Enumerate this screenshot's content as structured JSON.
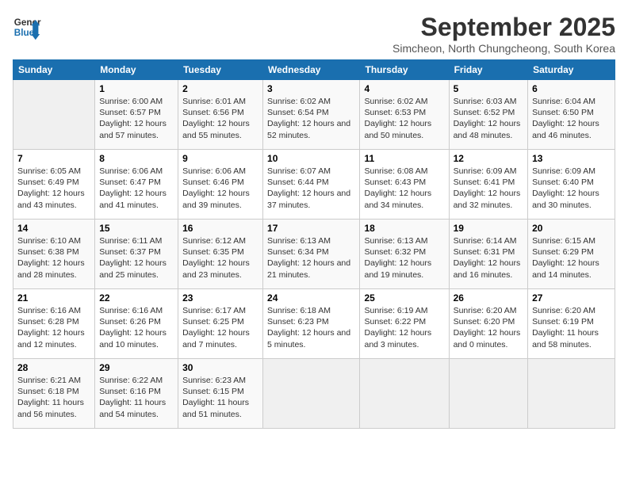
{
  "logo": {
    "line1": "General",
    "line2": "Blue"
  },
  "title": "September 2025",
  "subtitle": "Simcheon, North Chungcheong, South Korea",
  "days_of_week": [
    "Sunday",
    "Monday",
    "Tuesday",
    "Wednesday",
    "Thursday",
    "Friday",
    "Saturday"
  ],
  "weeks": [
    [
      {
        "day": "",
        "info": ""
      },
      {
        "day": "1",
        "info": "Sunrise: 6:00 AM\nSunset: 6:57 PM\nDaylight: 12 hours\nand 57 minutes."
      },
      {
        "day": "2",
        "info": "Sunrise: 6:01 AM\nSunset: 6:56 PM\nDaylight: 12 hours\nand 55 minutes."
      },
      {
        "day": "3",
        "info": "Sunrise: 6:02 AM\nSunset: 6:54 PM\nDaylight: 12 hours\nand 52 minutes."
      },
      {
        "day": "4",
        "info": "Sunrise: 6:02 AM\nSunset: 6:53 PM\nDaylight: 12 hours\nand 50 minutes."
      },
      {
        "day": "5",
        "info": "Sunrise: 6:03 AM\nSunset: 6:52 PM\nDaylight: 12 hours\nand 48 minutes."
      },
      {
        "day": "6",
        "info": "Sunrise: 6:04 AM\nSunset: 6:50 PM\nDaylight: 12 hours\nand 46 minutes."
      }
    ],
    [
      {
        "day": "7",
        "info": "Sunrise: 6:05 AM\nSunset: 6:49 PM\nDaylight: 12 hours\nand 43 minutes."
      },
      {
        "day": "8",
        "info": "Sunrise: 6:06 AM\nSunset: 6:47 PM\nDaylight: 12 hours\nand 41 minutes."
      },
      {
        "day": "9",
        "info": "Sunrise: 6:06 AM\nSunset: 6:46 PM\nDaylight: 12 hours\nand 39 minutes."
      },
      {
        "day": "10",
        "info": "Sunrise: 6:07 AM\nSunset: 6:44 PM\nDaylight: 12 hours\nand 37 minutes."
      },
      {
        "day": "11",
        "info": "Sunrise: 6:08 AM\nSunset: 6:43 PM\nDaylight: 12 hours\nand 34 minutes."
      },
      {
        "day": "12",
        "info": "Sunrise: 6:09 AM\nSunset: 6:41 PM\nDaylight: 12 hours\nand 32 minutes."
      },
      {
        "day": "13",
        "info": "Sunrise: 6:09 AM\nSunset: 6:40 PM\nDaylight: 12 hours\nand 30 minutes."
      }
    ],
    [
      {
        "day": "14",
        "info": "Sunrise: 6:10 AM\nSunset: 6:38 PM\nDaylight: 12 hours\nand 28 minutes."
      },
      {
        "day": "15",
        "info": "Sunrise: 6:11 AM\nSunset: 6:37 PM\nDaylight: 12 hours\nand 25 minutes."
      },
      {
        "day": "16",
        "info": "Sunrise: 6:12 AM\nSunset: 6:35 PM\nDaylight: 12 hours\nand 23 minutes."
      },
      {
        "day": "17",
        "info": "Sunrise: 6:13 AM\nSunset: 6:34 PM\nDaylight: 12 hours\nand 21 minutes."
      },
      {
        "day": "18",
        "info": "Sunrise: 6:13 AM\nSunset: 6:32 PM\nDaylight: 12 hours\nand 19 minutes."
      },
      {
        "day": "19",
        "info": "Sunrise: 6:14 AM\nSunset: 6:31 PM\nDaylight: 12 hours\nand 16 minutes."
      },
      {
        "day": "20",
        "info": "Sunrise: 6:15 AM\nSunset: 6:29 PM\nDaylight: 12 hours\nand 14 minutes."
      }
    ],
    [
      {
        "day": "21",
        "info": "Sunrise: 6:16 AM\nSunset: 6:28 PM\nDaylight: 12 hours\nand 12 minutes."
      },
      {
        "day": "22",
        "info": "Sunrise: 6:16 AM\nSunset: 6:26 PM\nDaylight: 12 hours\nand 10 minutes."
      },
      {
        "day": "23",
        "info": "Sunrise: 6:17 AM\nSunset: 6:25 PM\nDaylight: 12 hours\nand 7 minutes."
      },
      {
        "day": "24",
        "info": "Sunrise: 6:18 AM\nSunset: 6:23 PM\nDaylight: 12 hours\nand 5 minutes."
      },
      {
        "day": "25",
        "info": "Sunrise: 6:19 AM\nSunset: 6:22 PM\nDaylight: 12 hours\nand 3 minutes."
      },
      {
        "day": "26",
        "info": "Sunrise: 6:20 AM\nSunset: 6:20 PM\nDaylight: 12 hours\nand 0 minutes."
      },
      {
        "day": "27",
        "info": "Sunrise: 6:20 AM\nSunset: 6:19 PM\nDaylight: 11 hours\nand 58 minutes."
      }
    ],
    [
      {
        "day": "28",
        "info": "Sunrise: 6:21 AM\nSunset: 6:18 PM\nDaylight: 11 hours\nand 56 minutes."
      },
      {
        "day": "29",
        "info": "Sunrise: 6:22 AM\nSunset: 6:16 PM\nDaylight: 11 hours\nand 54 minutes."
      },
      {
        "day": "30",
        "info": "Sunrise: 6:23 AM\nSunset: 6:15 PM\nDaylight: 11 hours\nand 51 minutes."
      },
      {
        "day": "",
        "info": ""
      },
      {
        "day": "",
        "info": ""
      },
      {
        "day": "",
        "info": ""
      },
      {
        "day": "",
        "info": ""
      }
    ]
  ]
}
